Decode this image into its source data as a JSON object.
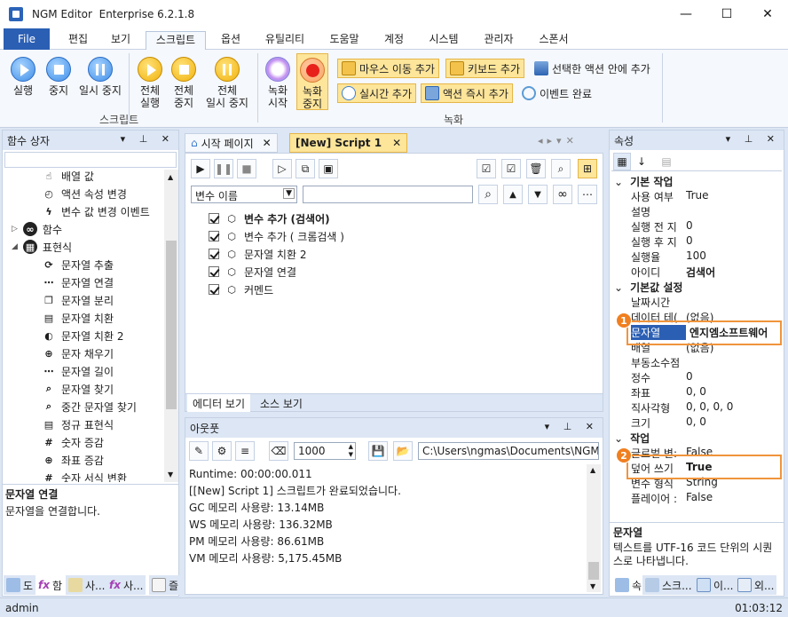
{
  "window": {
    "app": "NGM Editor",
    "edition": "Enterprise 6.2.1.8",
    "min_glyph": "—",
    "max_glyph": "☐",
    "close_glyph": "✕"
  },
  "menu": [
    "File",
    "편집",
    "보기",
    "스크립트",
    "옵션",
    "유틸리티",
    "도움말",
    "계정",
    "시스템",
    "관리자",
    "스폰서"
  ],
  "ribbon": {
    "run": "실행",
    "stop": "중지",
    "pause": "일시 중지",
    "run_all": [
      "전체",
      "실행"
    ],
    "stop_all": [
      "전체",
      "중지"
    ],
    "pause_all": [
      "전체",
      "일시 중지"
    ],
    "script_group": "스크립트",
    "rec_start": [
      "녹화",
      "시작"
    ],
    "rec_stop": [
      "녹화",
      "중지"
    ],
    "mouse_add": "마우스 이동 추가",
    "key_add": "키보드 추가",
    "in_action_add": "선택한 액션 안에 추가",
    "realtime_add": "실시간 추가",
    "action_now_add": "액션 즉시 추가",
    "event_done": "이벤트 완료",
    "record_group": "녹화"
  },
  "left_panel": {
    "title": "함수 상자",
    "items": [
      {
        "label": "배열 값",
        "icon": "pointer-icon"
      },
      {
        "label": "액션 속성 변경",
        "icon": "clock-icon"
      },
      {
        "label": "변수 값 변경 이벤트",
        "icon": "lightning-icon"
      },
      {
        "label": "함수",
        "icon": "infinity-icon",
        "expand": "▷"
      },
      {
        "label": "표현식",
        "icon": "grid-icon",
        "expand": "◢"
      },
      {
        "label": "문자열 추출",
        "icon": "refresh-icon"
      },
      {
        "label": "문자열 연결",
        "icon": "dots-icon"
      },
      {
        "label": "문자열 분리",
        "icon": "copy-icon"
      },
      {
        "label": "문자열 치환",
        "icon": "doc-icon"
      },
      {
        "label": "문자열 치환 2",
        "icon": "toggle-icon"
      },
      {
        "label": "문자 채우기",
        "icon": "target-icon"
      },
      {
        "label": "문자열 길이",
        "icon": "dots-icon"
      },
      {
        "label": "문자열 찾기",
        "icon": "search-icon"
      },
      {
        "label": "중간 문자열 찾기",
        "icon": "search-icon"
      },
      {
        "label": "정규 표현식",
        "icon": "doc-icon"
      },
      {
        "label": "숫자 증감",
        "icon": "number-icon"
      },
      {
        "label": "좌표 증감",
        "icon": "target-icon"
      },
      {
        "label": "숫자 서식 변환",
        "icon": "number-icon"
      }
    ],
    "desc_title": "문자열 연결",
    "desc_text": "문자열을 연결합니다.",
    "bottom_tabs": [
      "도",
      "함",
      "사...",
      "사...",
      "즐"
    ]
  },
  "editor": {
    "tabs": [
      "시작 페이지",
      "[New] Script 1"
    ],
    "var_select": "변수 이름",
    "rows": [
      {
        "label": "변수 추가 (검색어)",
        "bold": true
      },
      {
        "label": "변수 추가 ( 크롬검색 )",
        "bold": false
      },
      {
        "label": "문자열 치환 2",
        "bold": false
      },
      {
        "label": "문자열 연결",
        "bold": false
      },
      {
        "label": "커멘드",
        "bold": false
      }
    ],
    "view_tabs": [
      "에디터 보기",
      "소스 보기"
    ]
  },
  "output": {
    "title": "아웃풋",
    "count": "1000",
    "path": "C:\\Users\\ngmas\\Documents\\NGM6\\",
    "lines": [
      "Runtime: 00:00:00.011",
      "[[New] Script 1] 스크립트가 완료되었습니다.",
      "GC 메모리 사용량: 13.14MB",
      "WS 메모리 사용량: 136.32MB",
      "PM 메모리 사용량: 86.61MB",
      "VM 메모리 사용량: 5,175.45MB"
    ]
  },
  "props": {
    "title": "속성",
    "cat1": "기본 작업",
    "rows1": [
      [
        "사용 여부",
        "True"
      ],
      [
        "설명",
        ""
      ],
      [
        "실행 전 지",
        "0"
      ],
      [
        "실행 후 지",
        "0"
      ],
      [
        "실행율",
        "100"
      ],
      [
        "아이디",
        "검색어"
      ]
    ],
    "cat2": "기본값 설정",
    "rows2": [
      [
        "날짜시간",
        ""
      ],
      [
        "데이터 테(",
        "(없음)"
      ],
      [
        "문자열",
        "엔지엠소프트웨어"
      ],
      [
        "배열",
        "(없음)"
      ],
      [
        "부동소수점",
        ""
      ],
      [
        "정수",
        "0"
      ],
      [
        "좌표",
        "0, 0"
      ],
      [
        "직사각형",
        "0, 0, 0, 0"
      ],
      [
        "크기",
        "0, 0"
      ]
    ],
    "cat3": "작업",
    "rows3": [
      [
        "글로벌 변:",
        "False"
      ],
      [
        "덮어 쓰기",
        "True"
      ],
      [
        "변수 형식",
        "String"
      ],
      [
        "플레이어 :",
        "False"
      ]
    ],
    "desc_title": "문자열",
    "desc_text": "텍스트를 UTF-16 코드 단위의 시퀀스로 나타냅니다.",
    "bottom_tabs": [
      "속",
      "스크...",
      "이...",
      "외..."
    ],
    "marker1": "1",
    "marker2": "2"
  },
  "status": {
    "user": "admin",
    "time": "01:03:12"
  }
}
